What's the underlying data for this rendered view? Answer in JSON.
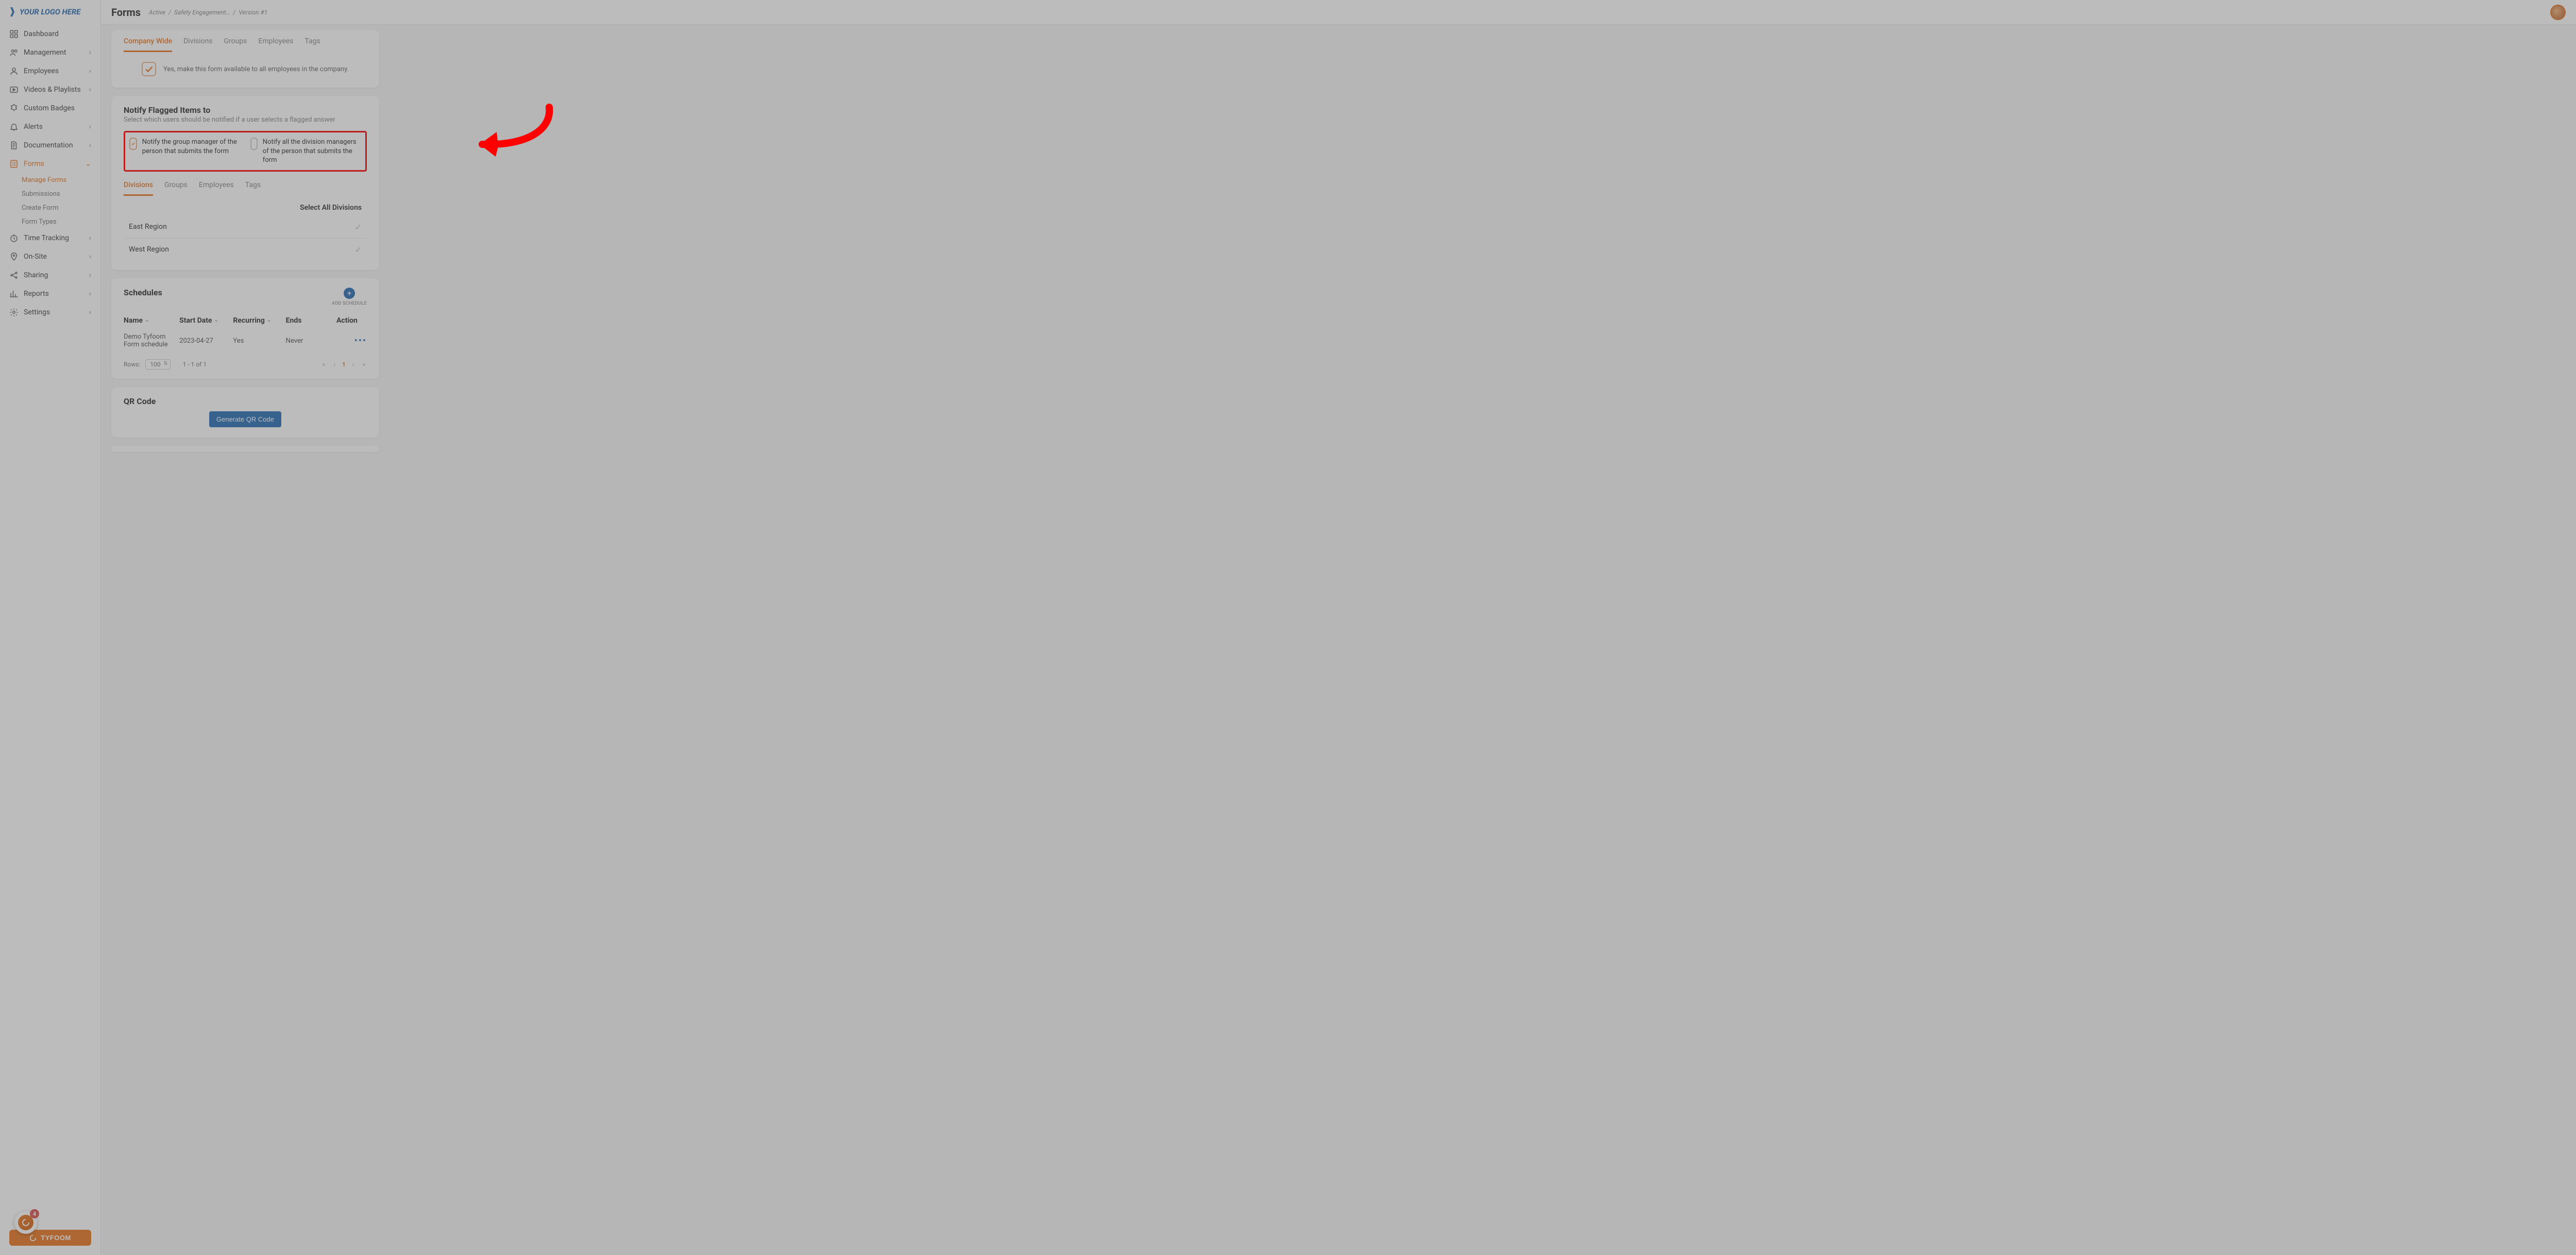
{
  "logo": {
    "text": "YOUR LOGO HERE",
    "sub": ""
  },
  "header": {
    "title": "Forms",
    "breadcrumb": [
      "Active",
      "Safety Engagement…",
      "Version #1"
    ]
  },
  "nav": {
    "items": [
      {
        "label": "Dashboard",
        "expandable": false
      },
      {
        "label": "Management",
        "expandable": true
      },
      {
        "label": "Employees",
        "expandable": true
      },
      {
        "label": "Videos & Playlists",
        "expandable": true
      },
      {
        "label": "Custom Badges",
        "expandable": false
      },
      {
        "label": "Alerts",
        "expandable": true
      },
      {
        "label": "Documentation",
        "expandable": true
      },
      {
        "label": "Forms",
        "expandable": true,
        "active": true
      },
      {
        "label": "Time Tracking",
        "expandable": true
      },
      {
        "label": "On-Site",
        "expandable": true
      },
      {
        "label": "Sharing",
        "expandable": true
      },
      {
        "label": "Reports",
        "expandable": true
      },
      {
        "label": "Settings",
        "expandable": true
      }
    ],
    "formsSub": [
      {
        "label": "Manage Forms",
        "active": true
      },
      {
        "label": "Submissions"
      },
      {
        "label": "Create Form"
      },
      {
        "label": "Form Types"
      }
    ],
    "spinCount": "4",
    "tyfoomBtn": "TYFOOM"
  },
  "availability": {
    "tabs": [
      "Company Wide",
      "Divisions",
      "Groups",
      "Employees",
      "Tags"
    ],
    "activeTab": 0,
    "checkbox": {
      "checked": true,
      "label": "Yes, make this form available to all employees in the company."
    }
  },
  "notify": {
    "title": "Notify Flagged Items to",
    "sub": "Select which users should be notified if a user selects a flagged answer",
    "opt1": {
      "checked": true,
      "label": "Notify the group manager of the person that submits the form"
    },
    "opt2": {
      "checked": false,
      "label": "Notify all the division managers of the person that submits the form"
    },
    "tabs": [
      "Divisions",
      "Groups",
      "Employees",
      "Tags"
    ],
    "activeTab": 0,
    "selectAll": "Select All Divisions",
    "divisions": [
      "East Region",
      "West Region"
    ]
  },
  "schedules": {
    "title": "Schedules",
    "addLabel": "ADD SCHEDULE",
    "columns": {
      "name": "Name",
      "start": "Start Date",
      "rec": "Recurring",
      "ends": "Ends",
      "action": "Action"
    },
    "rows": [
      {
        "name": "Demo Tyfoom Form schedule",
        "start": "2023-04-27",
        "rec": "Yes",
        "ends": "Never"
      }
    ],
    "pager": {
      "rowsLabel": "Rows:",
      "rowsValue": "100",
      "range": "1 - 1 of 1",
      "page": "1"
    }
  },
  "qr": {
    "title": "QR Code",
    "button": "Generate QR Code"
  },
  "colors": {
    "accent": "#e87722",
    "blue": "#2a6fb5",
    "red": "#ff0000"
  }
}
